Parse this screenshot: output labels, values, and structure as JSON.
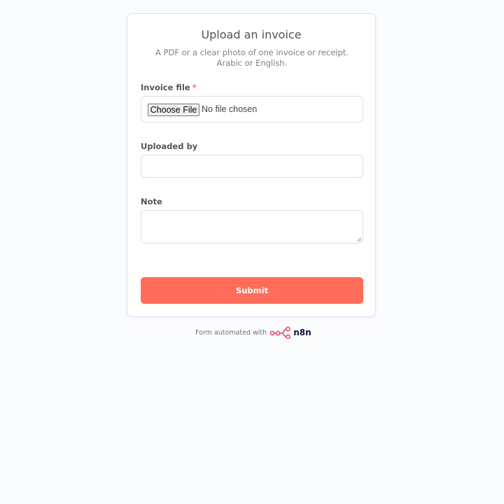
{
  "form": {
    "title": "Upload an invoice",
    "subtitle": "A PDF or a clear photo of one invoice or receipt. Arabic or English.",
    "fields": {
      "invoice_file": {
        "label": "Invoice file",
        "required_mark": "*",
        "button_label": "Choose File",
        "status_text": "No file chosen"
      },
      "uploaded_by": {
        "label": "Uploaded by",
        "value": "",
        "placeholder": ""
      },
      "note": {
        "label": "Note",
        "value": "",
        "placeholder": ""
      }
    },
    "submit_label": "Submit"
  },
  "footer": {
    "text": "Form automated with",
    "brand": "n8n",
    "logo_icon": "n8n-logo-icon"
  },
  "colors": {
    "accent": "#ff6d5a",
    "background": "#fbfcfe",
    "card_border": "#dbdfe7",
    "brand_pink": "#ea4b71"
  }
}
